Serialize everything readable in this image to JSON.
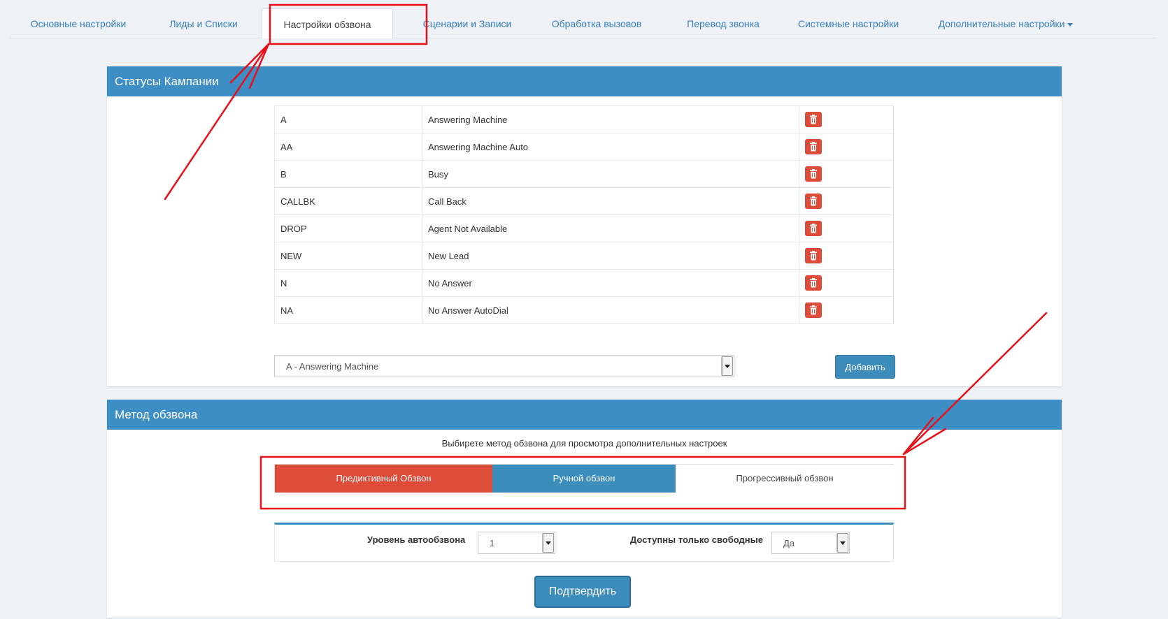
{
  "nav": {
    "tabs": [
      {
        "label": "Основные настройки"
      },
      {
        "label": "Лиды и Списки"
      },
      {
        "label": "Настройки обзвона"
      },
      {
        "label": "Сценарии и Записи"
      },
      {
        "label": "Обработка вызовов"
      },
      {
        "label": "Перевод звонка"
      },
      {
        "label": "Системные настройки"
      },
      {
        "label": "Дополнительные настройки"
      }
    ],
    "active_tab": "Настройки обзвона"
  },
  "statuses_panel": {
    "title": "Статусы Кампании",
    "rows": [
      {
        "code": "A",
        "name": "Answering Machine"
      },
      {
        "code": "AA",
        "name": "Answering Machine Auto"
      },
      {
        "code": "B",
        "name": "Busy"
      },
      {
        "code": "CALLBK",
        "name": "Call Back"
      },
      {
        "code": "DROP",
        "name": "Agent Not Available"
      },
      {
        "code": "NEW",
        "name": "New Lead"
      },
      {
        "code": "N",
        "name": "No Answer"
      },
      {
        "code": "NA",
        "name": "No Answer AutoDial"
      }
    ],
    "status_select_value": "A - Answering Machine",
    "add_button": "Добавить"
  },
  "method_panel": {
    "title": "Метод обзвона",
    "hint": "Выбирете метод обзвона для просмотра дополнительных настроек",
    "methods": [
      {
        "label": "Предиктивный Обзвон"
      },
      {
        "label": "Ручной обзвон"
      },
      {
        "label": "Прогрессивный обзвон"
      }
    ],
    "autodial_level_label": "Уровень автообзвона",
    "autodial_level_value": "1",
    "available_only_label": "Доступны только свободные",
    "available_only_value": "Да",
    "confirm_button": "Подтвердить"
  },
  "colors": {
    "panel_header": "#3d8ec4",
    "danger": "#dd4b39",
    "primary": "#3c8dbc",
    "annotation": "#e8101a"
  }
}
